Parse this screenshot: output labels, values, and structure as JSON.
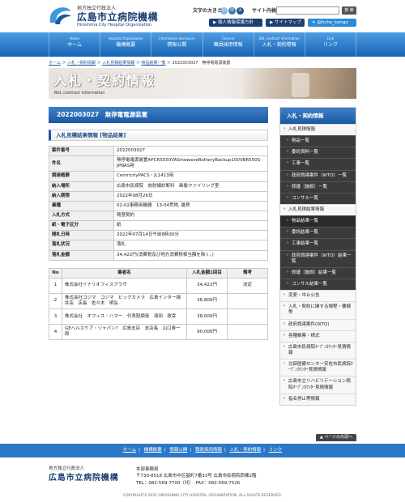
{
  "header": {
    "org_small": "地方独立行政法人",
    "org_name": "広島市立病院機構",
    "org_en": "Hiroshima City Hospital Organization",
    "fontsize_label": "文字の大きさ",
    "fontsize_small": "小",
    "fontsize_mid": "中",
    "fontsize_large": "大",
    "search_label": "サイト内検索",
    "search_placeholder": "",
    "search_button": "検 索",
    "privacy_link": "個人情報保護方針",
    "sitemap_link": "サイトマップ",
    "twitter_link": "@hcho_kango"
  },
  "gnav": [
    {
      "en": "Home",
      "ja": "ホーム"
    },
    {
      "en": "Hospital Organization",
      "ja": "機構概要"
    },
    {
      "en": "Information disclosure",
      "ja": "情報公開"
    },
    {
      "en": "Careers",
      "ja": "職員採用情報"
    },
    {
      "en": "Bid, contract information",
      "ja": "入札・契約情報"
    },
    {
      "en": "Link",
      "ja": "リンク"
    }
  ],
  "breadcrumb": {
    "items": [
      "ホーム",
      "入札・契約情報",
      "入札見積結果情報",
      "物品結果一覧"
    ],
    "current": "2022003027　無停電電源装置"
  },
  "hero": {
    "title": "入札・契約情報",
    "subtitle": "Bid, contract information"
  },
  "main": {
    "page_title": "2022003027　無停電電源装置",
    "section_title": "入札見積結果情報 [物品結果]",
    "details": [
      {
        "label": "案件番号",
        "value": "2022003027"
      },
      {
        "label": "件名",
        "value": "無停電電源装置APCRS550VASinewaveBatteryBackup100VBR550S-JPNAS用"
      },
      {
        "label": "調達概要",
        "value": "CentricityPACS・JL1413用"
      },
      {
        "label": "納入場所",
        "value": "広島市民病院　放射線診断科　画像ファイリング室"
      },
      {
        "label": "納入期限",
        "value": "2022年08月26日"
      },
      {
        "label": "業種",
        "value": "02-02事務用機器　13-04荒物, 雑貨"
      },
      {
        "label": "入札方式",
        "value": "随意契約"
      },
      {
        "label": "紙・電子区分",
        "value": "紙"
      },
      {
        "label": "開札日時",
        "value": "2022年07月14日午前8時30分"
      },
      {
        "label": "落札状況",
        "value": "落札"
      },
      {
        "label": "落札金額",
        "value": "34,422円(消費税及び地方消費税相当額を除く｡)"
      }
    ],
    "results_headers": {
      "no": "No",
      "name": "業者名",
      "amount": "入札金額1回目",
      "note": "備考"
    },
    "results": [
      {
        "no": "1",
        "name": "株式会社イナリオフィスブラザ",
        "amount": "34,422円",
        "note": "決定"
      },
      {
        "no": "2",
        "name": "株式会社コジマ　コジマ　ビックカメラ　広島インター緑井店　店長　佐々木　明弘",
        "amount": "36,800円",
        "note": ""
      },
      {
        "no": "3",
        "name": "株式会社　オフィス・ハマー　代表取締役　濱田　政幸",
        "amount": "38,000円",
        "note": ""
      },
      {
        "no": "4",
        "name": "GEヘルスケア・ジャパン?　広島支店　支店長　山口寿一郎",
        "amount": "90,000円",
        "note": ""
      }
    ]
  },
  "side": {
    "title": "入札・契約情報",
    "items": [
      {
        "label": "入札見積情報",
        "type": "item"
      },
      {
        "label": "物品一覧",
        "type": "sub"
      },
      {
        "label": "委託資料一覧",
        "type": "sub"
      },
      {
        "label": "工事一覧",
        "type": "sub"
      },
      {
        "label": "政府調達案件（WTO）一覧",
        "type": "sub"
      },
      {
        "label": "修繕（施設）一覧",
        "type": "sub"
      },
      {
        "label": "コンサル一覧",
        "type": "sub"
      },
      {
        "label": "入札見積結果情報",
        "type": "item"
      },
      {
        "label": "物品結果一覧",
        "type": "sub"
      },
      {
        "label": "委託結果一覧",
        "type": "sub"
      },
      {
        "label": "工事結果一覧",
        "type": "sub"
      },
      {
        "label": "政府調達案件（WTO）結果一覧",
        "type": "sub"
      },
      {
        "label": "修繕（施設）結果一覧",
        "type": "sub"
      },
      {
        "label": "コンサル結果一覧",
        "type": "sub"
      },
      {
        "label": "変更・中止公告",
        "type": "item"
      },
      {
        "label": "入札・契約に関する規程・要綱等",
        "type": "item"
      },
      {
        "label": "政府調達案件(WTO)",
        "type": "item"
      },
      {
        "label": "各種帳票・様式",
        "type": "item"
      },
      {
        "label": "広島市民病院ｵｰﾌﾟﾝｶｳﾝﾀｰ見積情報",
        "type": "item"
      },
      {
        "label": "北部医療センター安佐市民病院ｵｰﾌﾟﾝｶｳﾝﾀｰ見積情報",
        "type": "item"
      },
      {
        "label": "広島市立リハビリテーション病院ｵｰﾌﾟﾝｶｳﾝﾀｰ見積情報",
        "type": "item"
      },
      {
        "label": "指名停止等情報",
        "type": "item"
      }
    ]
  },
  "page_top": "ページの先頭へ",
  "footer": {
    "links": [
      "ホーム",
      "機構概要",
      "情報公開",
      "職員採用情報",
      "入札・契約情報",
      "リンク"
    ],
    "org_small": "地方独立行政法人",
    "org_name": "広島市立病院機構",
    "addr_title": "本部事務局",
    "addr_line1": "〒730-8518 広島市中区基町7番33号 広島市民病院西棟2階",
    "addr_line2": "TEL：082-569-7700（代）　FAX：082-569-7526",
    "copyright": "COPYRIGHT©2022 HIROSHIMA CITY HOSPITAL ORGANIZATION. ALL RIGHTS RESERVED."
  },
  "colors": {
    "brand": "#1c3f74",
    "nav": "#2d77c7",
    "accent": "#1c5aa3"
  }
}
